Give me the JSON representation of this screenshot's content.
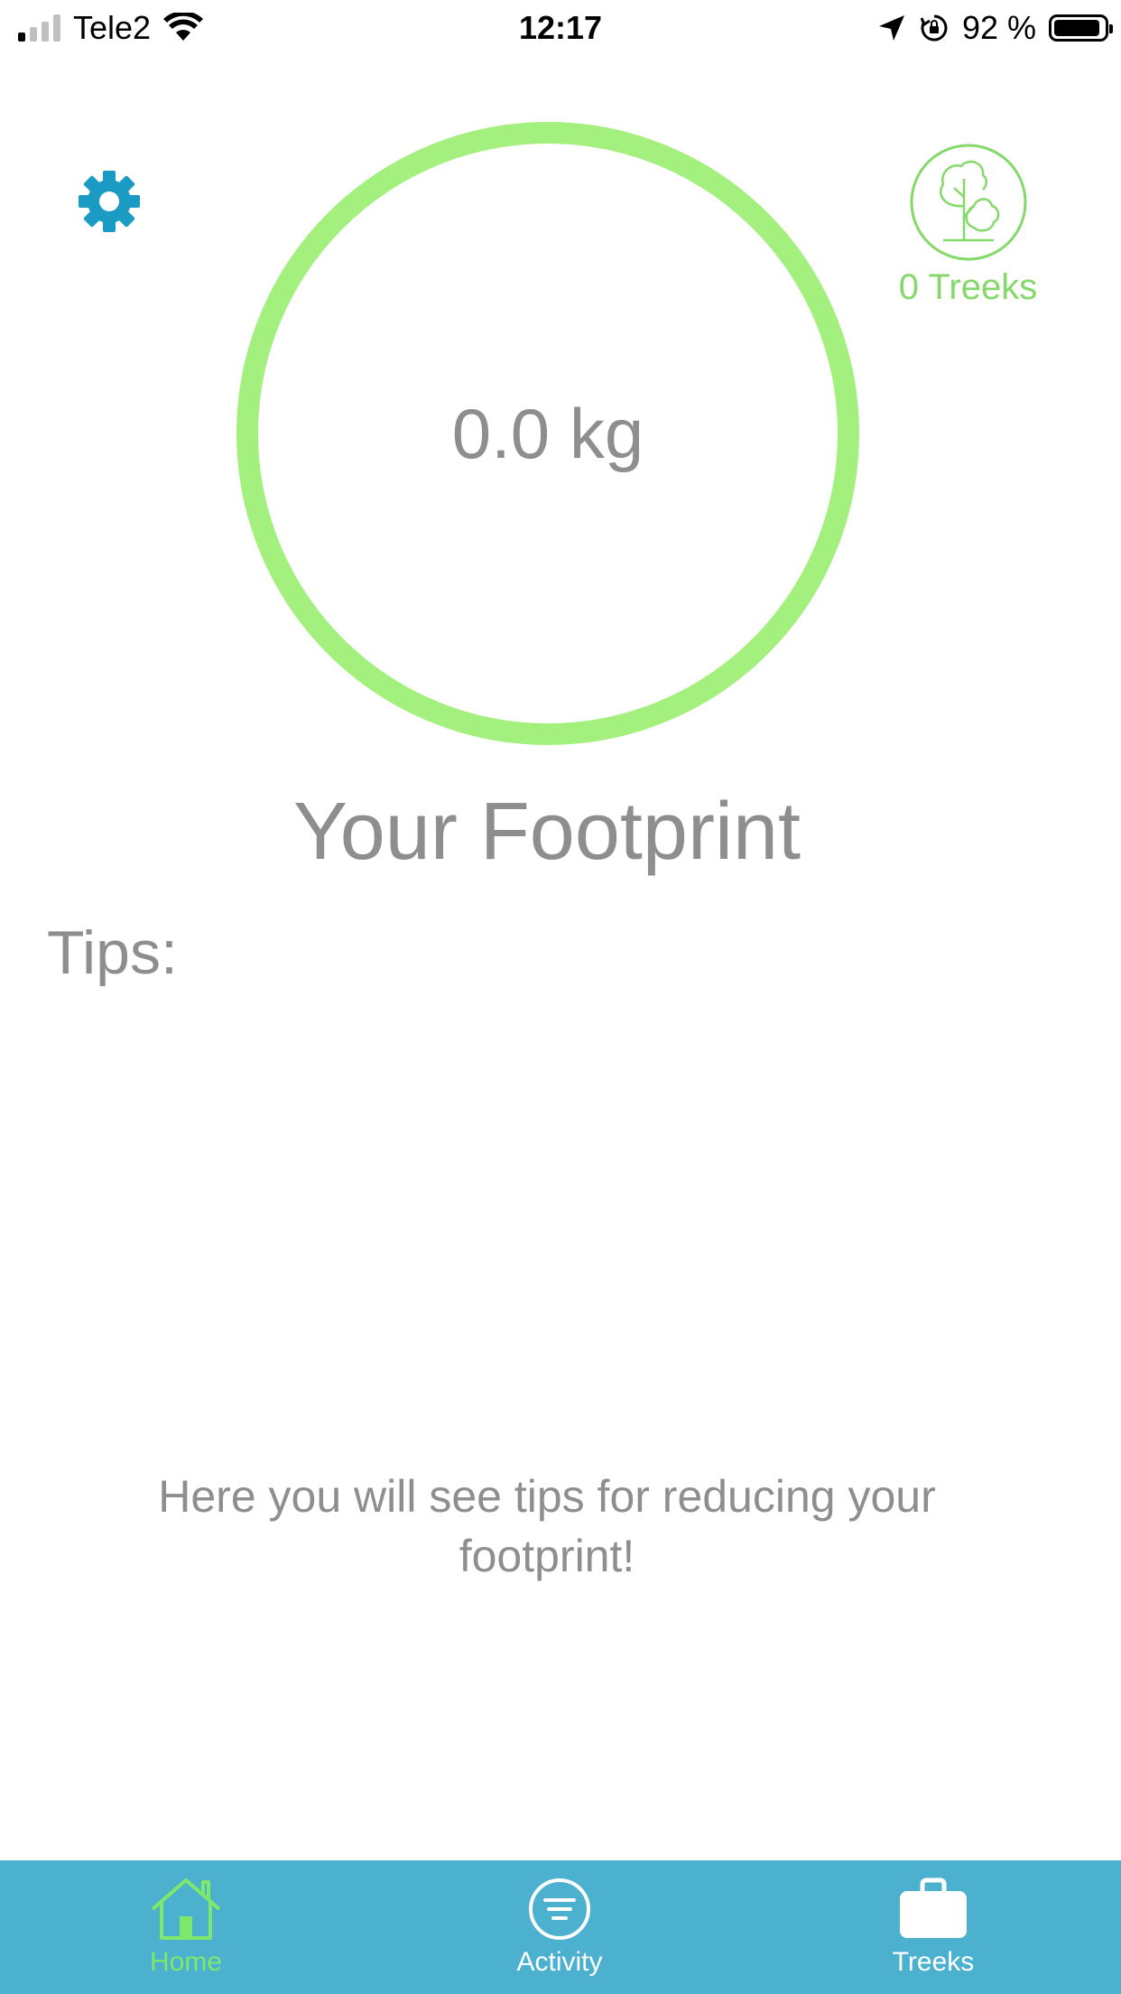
{
  "status_bar": {
    "carrier": "Tele2",
    "time": "12:17",
    "battery_percent": "92 %",
    "battery_level": 0.92,
    "signal_bars_on": 1,
    "icons": [
      "signal-icon",
      "wifi-icon",
      "location-arrow-icon",
      "rotation-lock-icon",
      "battery-icon"
    ]
  },
  "header": {
    "settings_icon": "gear-icon",
    "treeks_icon": "tree-icon",
    "treeks_count": "0 Treeks"
  },
  "footprint": {
    "value": "0.0 kg",
    "title": "Your Footprint"
  },
  "tips": {
    "heading": "Tips:",
    "placeholder": "Here you will see tips for reducing your footprint!"
  },
  "tab_bar": {
    "tabs": [
      {
        "label": "Home",
        "icon": "home-icon",
        "active": true
      },
      {
        "label": "Activity",
        "icon": "activity-icon",
        "active": false
      },
      {
        "label": "Treeks",
        "icon": "briefcase-icon",
        "active": false
      }
    ]
  },
  "colors": {
    "accent_green": "#a3f07e",
    "treeks_green": "#85d96a",
    "settings_blue": "#1a9bc4",
    "tab_bar": "#4cb1cf",
    "tab_active": "#7ee86a",
    "text_gray": "#8e8e8e"
  }
}
